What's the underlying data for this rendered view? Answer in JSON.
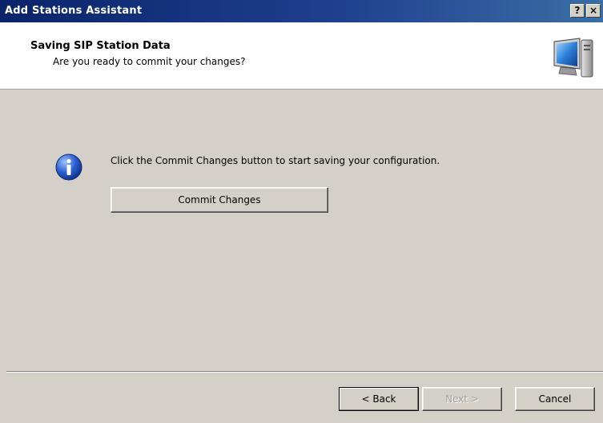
{
  "window": {
    "title": "Add Stations Assistant",
    "help_label": "?",
    "close_label": "×"
  },
  "header": {
    "title": "Saving SIP Station Data",
    "subtitle": "Are you ready to commit your changes?",
    "icon": "computer-monitor-icon"
  },
  "content": {
    "info_icon": "info-icon",
    "message": "Click the Commit Changes button to start saving your configuration.",
    "commit_label": "Commit Changes"
  },
  "footer": {
    "back_label": "< Back",
    "next_label": "Next >",
    "cancel_label": "Cancel"
  },
  "colors": {
    "titlebar": "#0a246a",
    "dialog_face": "#d4d0c8",
    "header_bg": "#ffffff",
    "info_blue": "#1f4fb5"
  }
}
